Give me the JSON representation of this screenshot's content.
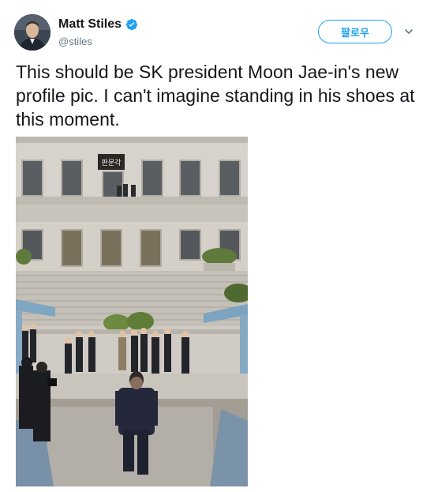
{
  "tweet": {
    "author": {
      "display_name": "Matt Stiles",
      "handle": "@stiles",
      "verified": true,
      "verified_icon": "verified-badge-icon",
      "avatar_icon": "avatar"
    },
    "follow_button_label": "팔로우",
    "more_options_icon": "chevron-down-icon",
    "text": "This should be SK president Moon Jae-in's new profile pic. I can't imagine standing in his shoes at this moment.",
    "media": {
      "sign_text": "판문각"
    },
    "colors": {
      "accent": "#1da1f2",
      "text": "#14171a",
      "secondary": "#657786"
    }
  }
}
